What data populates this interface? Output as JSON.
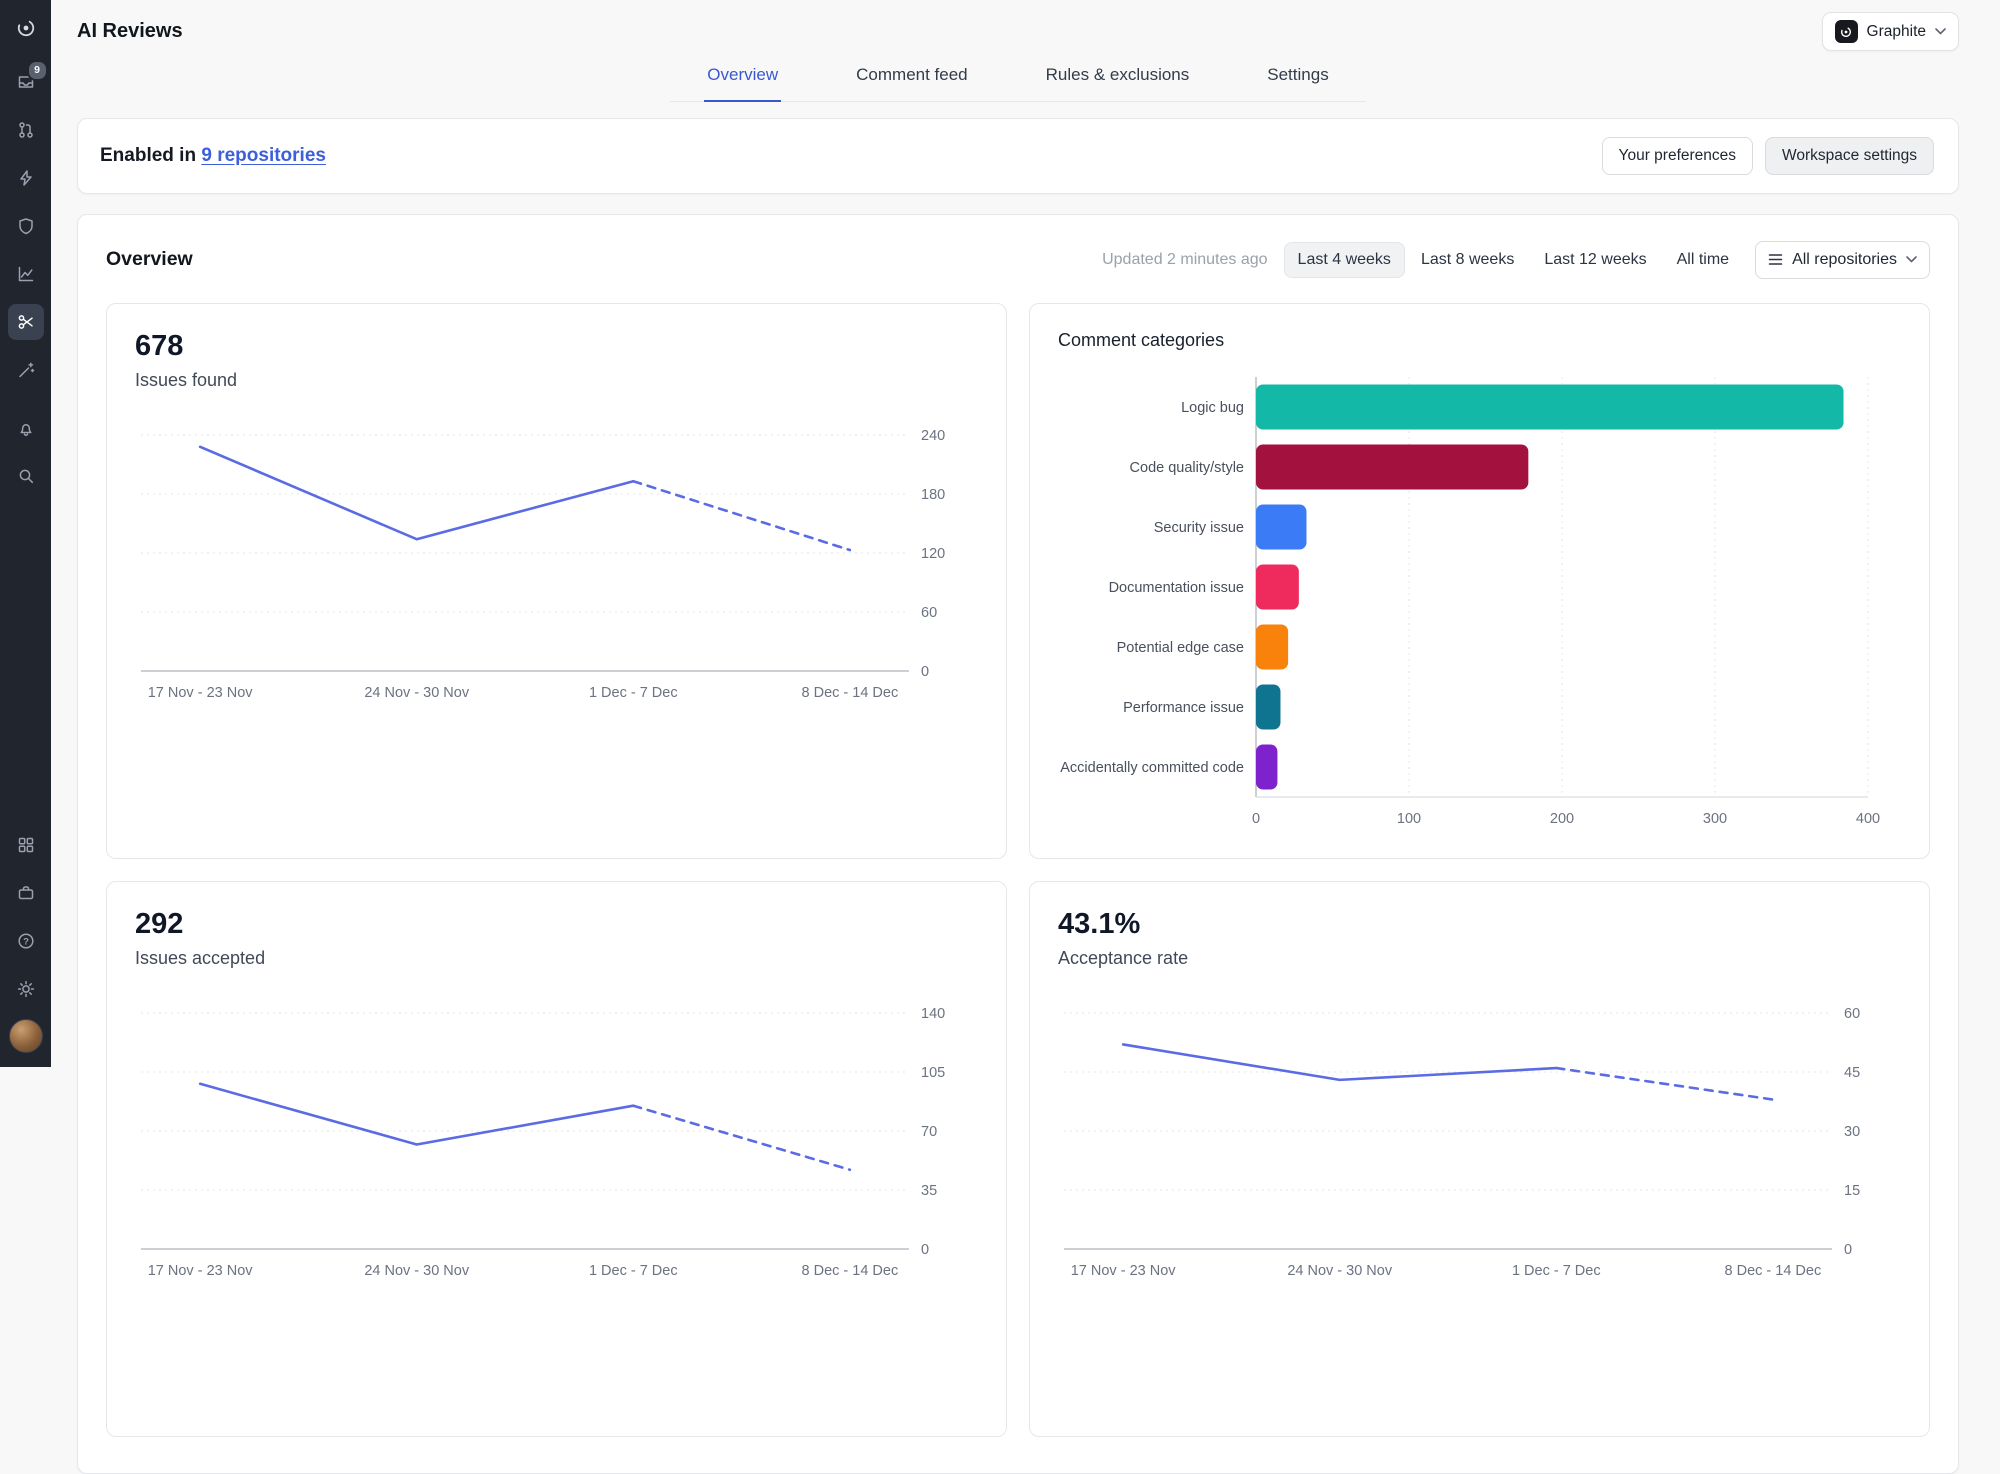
{
  "header": {
    "title": "AI Reviews",
    "workspace_button": {
      "label": "Graphite"
    }
  },
  "tabs": {
    "active": "Overview",
    "items": [
      {
        "label": "Overview"
      },
      {
        "label": "Comment feed"
      },
      {
        "label": "Rules & exclusions"
      },
      {
        "label": "Settings"
      }
    ]
  },
  "banner": {
    "prefix": "Enabled in ",
    "link_text": "9 repositories",
    "pref_button": "Your preferences",
    "settings_button": "Workspace settings"
  },
  "overview": {
    "title": "Overview",
    "updated": "Updated 2 minutes ago",
    "range_buttons": [
      "Last 4 weeks",
      "Last 8 weeks",
      "Last 12 weeks",
      "All time"
    ],
    "active_range": "Last 4 weeks",
    "repo_dropdown": "All repositories"
  },
  "sidebar": {
    "inbox_badge": "9",
    "icons": [
      "graphite-logo",
      "inbox",
      "pull-request",
      "lightning",
      "shield",
      "insights",
      "ai-reviews",
      "magic-wand",
      "notifications",
      "search",
      "apps-grid",
      "workspace",
      "help",
      "settings",
      "user-avatar"
    ],
    "selected": "ai-reviews"
  },
  "colors": {
    "accent_blue": "#3a57d2",
    "line_blue": "#5b6be4",
    "sidebar_bg": "#20252e"
  },
  "chart_data": [
    {
      "id": "issues_found",
      "type": "line",
      "metric_value": "678",
      "metric_label": "Issues found",
      "x": [
        "17 Nov - 23 Nov",
        "24 Nov - 30 Nov",
        "1 Dec - 7 Dec",
        "8 Dec - 14 Dec"
      ],
      "values": [
        228,
        134,
        193,
        123
      ],
      "ylim": [
        0,
        240
      ],
      "yticks": [
        0,
        60,
        120,
        180,
        240
      ],
      "dashed_last_segment": true,
      "line_color": "#5b6be4"
    },
    {
      "id": "comment_categories",
      "type": "bar",
      "title": "Comment categories",
      "orientation": "horizontal",
      "categories": [
        "Logic bug",
        "Code quality/style",
        "Security issue",
        "Documentation issue",
        "Potential edge case",
        "Performance issue",
        "Accidentally committed code"
      ],
      "values": [
        384,
        178,
        33,
        28,
        21,
        16,
        14
      ],
      "colors": [
        "#14b8a6",
        "#a3123f",
        "#3b7cf6",
        "#ee2b5c",
        "#f9820c",
        "#0e7490",
        "#7e22ce"
      ],
      "xlim": [
        0,
        400
      ],
      "xticks": [
        0,
        100,
        200,
        300,
        400
      ]
    },
    {
      "id": "issues_accepted",
      "type": "line",
      "metric_value": "292",
      "metric_label": "Issues accepted",
      "x": [
        "17 Nov - 23 Nov",
        "24 Nov - 30 Nov",
        "1 Dec - 7 Dec",
        "8 Dec - 14 Dec"
      ],
      "values": [
        98,
        62,
        85,
        47
      ],
      "ylim": [
        0,
        140
      ],
      "yticks": [
        0,
        35,
        70,
        105,
        140
      ],
      "dashed_last_segment": true,
      "line_color": "#5b6be4"
    },
    {
      "id": "acceptance_rate",
      "type": "line",
      "metric_value": "43.1%",
      "metric_label": "Acceptance rate",
      "x": [
        "17 Nov - 23 Nov",
        "24 Nov - 30 Nov",
        "1 Dec - 7 Dec",
        "8 Dec - 14 Dec"
      ],
      "values": [
        52,
        43,
        46,
        38
      ],
      "ylim": [
        0,
        60
      ],
      "yticks": [
        0,
        15,
        30,
        45,
        60
      ],
      "dashed_last_segment": true,
      "line_color": "#5b6be4"
    }
  ]
}
